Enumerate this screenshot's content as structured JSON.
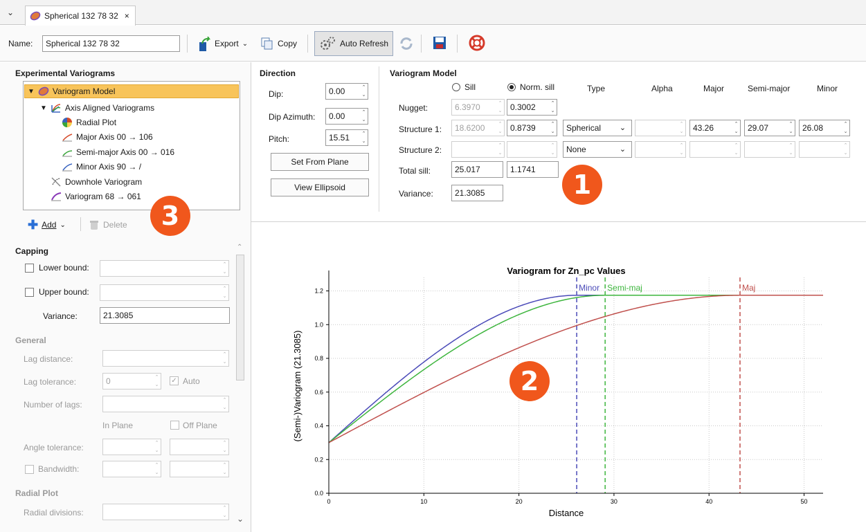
{
  "tab": {
    "chevron": "chevron-down-icon",
    "title": "Spherical 132 78 32",
    "close": "×"
  },
  "toolbar": {
    "name_label": "Name:",
    "name_value": "Spherical 132 78 32",
    "export_label": "Export",
    "copy_label": "Copy",
    "auto_refresh_label": "Auto Refresh"
  },
  "experimental": {
    "title": "Experimental Variograms",
    "items": [
      {
        "label": "Variogram Model",
        "icon": "variogram-model-icon"
      },
      {
        "label": "Axis Aligned Variograms",
        "icon": "axis-aligned-icon"
      },
      {
        "label": "Radial Plot",
        "icon": "radial-plot-icon"
      },
      {
        "label": "Major Axis 00 → 106",
        "icon": "major-axis-icon"
      },
      {
        "label": "Semi-major Axis 00 → 016",
        "icon": "semi-major-axis-icon"
      },
      {
        "label": "Minor Axis 90 → /",
        "icon": "minor-axis-icon"
      },
      {
        "label": "Downhole Variogram",
        "icon": "downhole-icon"
      },
      {
        "label": "Variogram 68 → 061",
        "icon": "variogram-icon"
      }
    ],
    "add_label": "Add",
    "delete_label": "Delete"
  },
  "capping": {
    "title": "Capping",
    "lower_label": "Lower bound:",
    "upper_label": "Upper bound:",
    "variance_label": "Variance:",
    "variance_value": "21.3085"
  },
  "general": {
    "title": "General",
    "lag_distance_label": "Lag distance:",
    "lag_tolerance_label": "Lag tolerance:",
    "lag_tolerance_value": "0",
    "auto_label": "Auto",
    "num_lags_label": "Number of lags:",
    "in_plane_label": "In Plane",
    "off_plane_label": "Off Plane",
    "angle_tol_label": "Angle tolerance:",
    "bandwidth_label": "Bandwidth:"
  },
  "radial": {
    "title": "Radial Plot",
    "divisions_label": "Radial divisions:"
  },
  "direction": {
    "title": "Direction",
    "dip_label": "Dip:",
    "dip_value": "0.00",
    "dip_az_label": "Dip Azimuth:",
    "dip_az_value": "0.00",
    "pitch_label": "Pitch:",
    "pitch_value": "15.51",
    "set_from_plane": "Set From Plane",
    "view_ellipsoid": "View Ellipsoid"
  },
  "model": {
    "title": "Variogram Model",
    "sill_label": "Sill",
    "norm_sill_label": "Norm. sill",
    "col_type": "Type",
    "col_alpha": "Alpha",
    "col_major": "Major",
    "col_semimajor": "Semi-major",
    "col_minor": "Minor",
    "nugget_label": "Nugget:",
    "nugget_sill": "6.3970",
    "nugget_norm": "0.3002",
    "s1_label": "Structure 1:",
    "s1_sill": "18.6200",
    "s1_norm": "0.8739",
    "s1_type": "Spherical",
    "s1_major": "43.26",
    "s1_semimajor": "29.07",
    "s1_minor": "26.08",
    "s2_label": "Structure 2:",
    "s2_type": "None",
    "total_label": "Total sill:",
    "total_sill": "25.017",
    "total_norm": "1.1741",
    "variance_label": "Variance:",
    "variance_value": "21.3085"
  },
  "badges": {
    "one": "1",
    "two": "2",
    "three": "3"
  },
  "chart_data": {
    "type": "line",
    "title": "Variogram for Zn_pc Values",
    "xlabel": "Distance",
    "ylabel": "(Semi-)Variogram (21.3085)",
    "xlim": [
      0,
      52
    ],
    "ylim": [
      0,
      1.28
    ],
    "xticks": [
      0,
      10,
      20,
      30,
      40,
      50
    ],
    "yticks": [
      0.0,
      0.2,
      0.4,
      0.6,
      0.8,
      1.0,
      1.2
    ],
    "grid": true,
    "nugget": 0.3002,
    "sill": 1.1741,
    "series": [
      {
        "range": 26.08,
        "color": "#4a4ab8"
      },
      {
        "range": 29.07,
        "color": "#3db53d"
      },
      {
        "range": 43.26,
        "color": "#c0504d"
      }
    ],
    "markers": [
      {
        "name": "Minor",
        "x": 26.08,
        "color": "#4a4ab8"
      },
      {
        "name": "Semi-maj",
        "x": 29.07,
        "color": "#3db53d"
      },
      {
        "name": "Maj",
        "x": 43.26,
        "color": "#c0504d"
      }
    ]
  }
}
